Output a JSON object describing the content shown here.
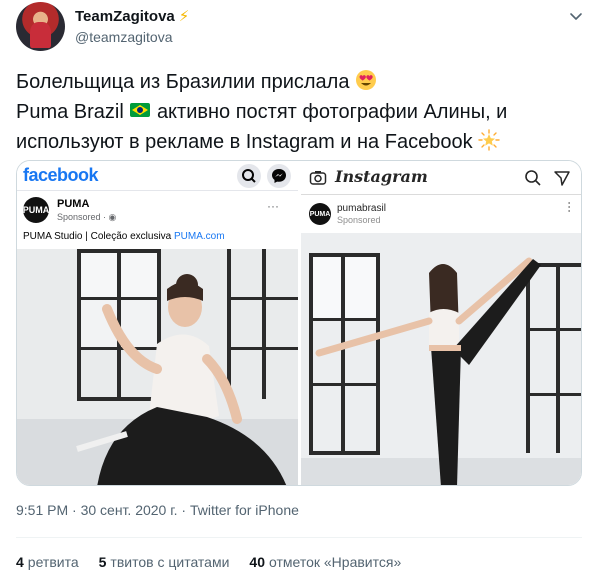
{
  "header": {
    "display_name": "TeamZagitova",
    "handle": "@teamzagitova",
    "verified_glyph": "⚡"
  },
  "tweet": {
    "line1": "Болельщица из Бразилии прислала",
    "line2_a": "Puma Brazil",
    "line2_b": "активно постят фотографии Алины, и",
    "line3": "используют в рекламе в Instagram и на Facebook",
    "emojis": [
      "heart-eyes-emoji",
      "brazil-flag-emoji",
      "glowing-star-emoji"
    ]
  },
  "media": {
    "facebook": {
      "logo": "facebook",
      "brand": "PUMA",
      "brand_mark": "PUMA",
      "sponsored": "Sponsored · ",
      "caption": "PUMA Studio | Coleção exclusiva ",
      "caption_link": "PUMA.com"
    },
    "instagram": {
      "logo": "Instagram",
      "brand": "pumabrasil",
      "brand_mark": "PUMA",
      "sponsored": "Sponsored"
    }
  },
  "footer": {
    "timestamp": "9:51 PM · 30 сент. 2020 г. · Twitter for iPhone",
    "retweets_count": "4",
    "retweets_label": "ретвита",
    "quotes_count": "5",
    "quotes_label": "твитов с цитатами",
    "likes_count": "40",
    "likes_label": "отметок «Нравится»"
  },
  "colors": {
    "text_primary": "#0f1419",
    "text_secondary": "#536471",
    "facebook_blue": "#1877f2",
    "border": "#cfd9de"
  }
}
